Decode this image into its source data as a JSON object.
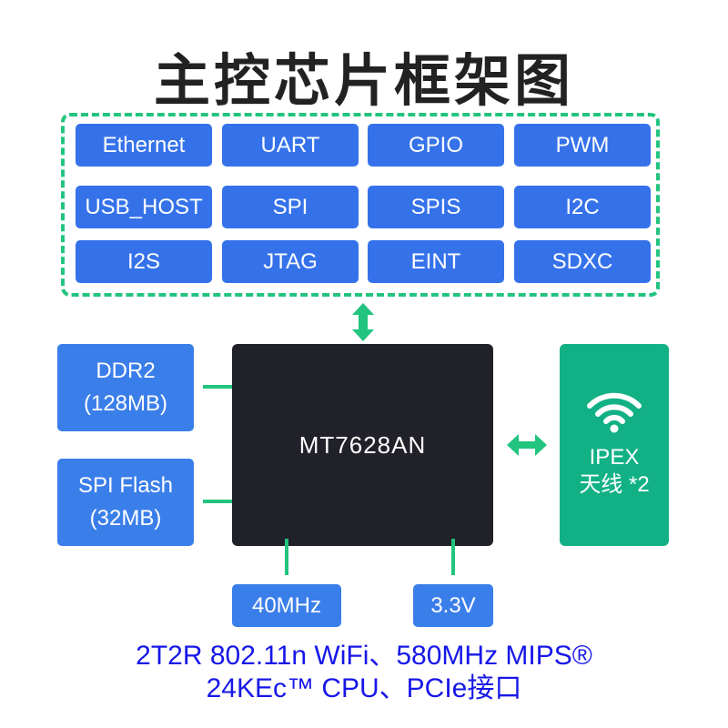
{
  "title": "主控芯片框架图",
  "peripherals": [
    [
      "Ethernet",
      "UART",
      "GPIO",
      "PWM"
    ],
    [
      "USB_HOST",
      "SPI",
      "SPIS",
      "I2C"
    ],
    [
      "I2S",
      "JTAG",
      "EINT",
      "SDXC"
    ]
  ],
  "memory": {
    "ddr": {
      "line1": "DDR2",
      "line2": "(128MB)"
    },
    "flash": {
      "line1": "SPI Flash",
      "line2": "(32MB)"
    }
  },
  "chip": {
    "name": "MT7628AN"
  },
  "antenna": {
    "icon": "wifi-icon",
    "line1": "IPEX",
    "line2": "天线 *2"
  },
  "clock": {
    "label": "40MHz"
  },
  "power": {
    "label": "3.3V"
  },
  "footer": {
    "line1": "2T2R 802.11n WiFi、580MHz MIPS®",
    "line2": "24KEc™ CPU、PCIe接口"
  },
  "colors": {
    "peripheral_box": "#3572ea",
    "connector": "#22c47e",
    "chip": "#21212a",
    "antenna_box": "#12b185",
    "footer_text": "#1717e8"
  }
}
